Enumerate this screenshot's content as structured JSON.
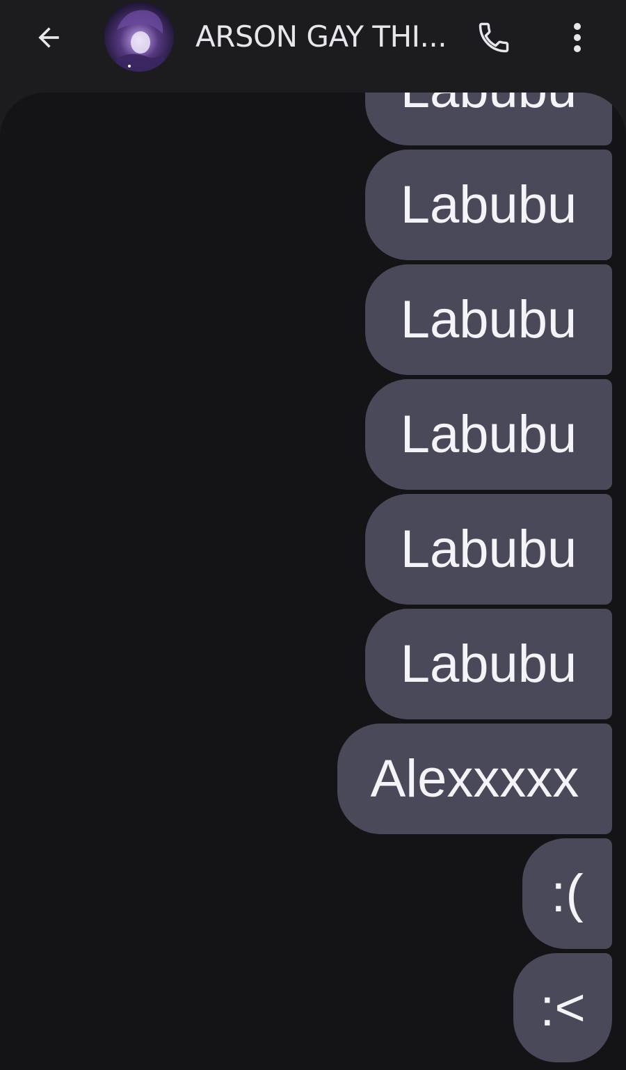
{
  "header": {
    "back_icon": "arrow-back-icon",
    "avatar_alt": "",
    "title": "ARSON GAY THI...",
    "call_icon": "phone-icon",
    "more_icon": "more-vert-icon"
  },
  "colors": {
    "header_bg": "#1c1c1f",
    "conversation_bg": "#141416",
    "bubble_bg": "#4a4959",
    "bubble_text": "#f4f3f8",
    "icon": "#e8e6ec"
  },
  "messages": [
    {
      "text": "Labubu"
    },
    {
      "text": "Labubu"
    },
    {
      "text": "Labubu"
    },
    {
      "text": "Labubu"
    },
    {
      "text": "Labubu"
    },
    {
      "text": "Labubu"
    },
    {
      "text": "Alexxxxx"
    },
    {
      "text": ":("
    },
    {
      "text": ":<"
    }
  ]
}
